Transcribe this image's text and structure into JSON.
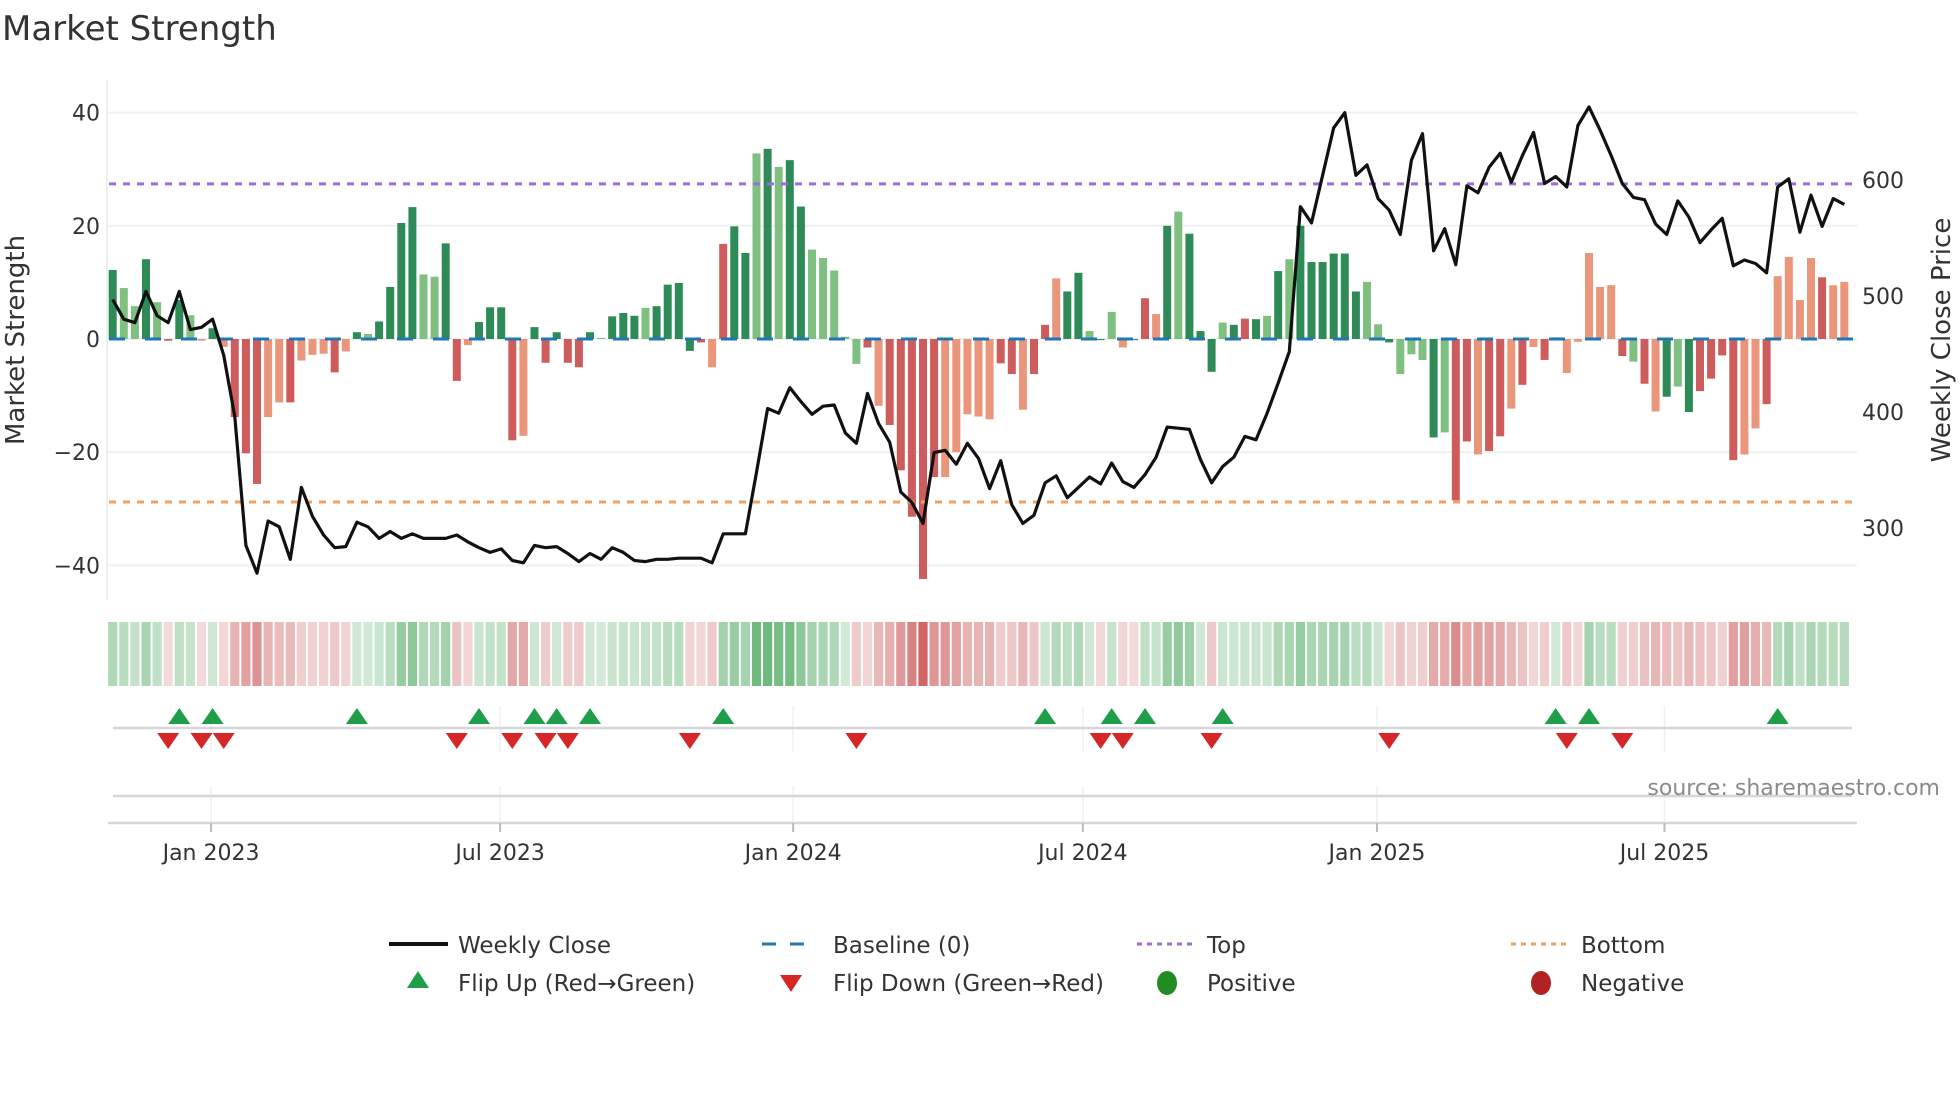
{
  "title": "Market Strength",
  "source": "source: sharemaestro.com",
  "colors": {
    "bar_strong_positive": "#2e8b57",
    "bar_weak_positive": "#7fbf7f",
    "bar_strong_negative": "#cd5c5c",
    "bar_weak_negative": "#e9967a",
    "baseline": "#1f77b4",
    "top": "#9b6cdc",
    "bottom": "#f0a060",
    "close": "#111111",
    "flip_up": "#1f9e4a",
    "flip_down": "#d62728",
    "positive": "#228b22",
    "negative": "#b22222"
  },
  "legend": {
    "weekly_close": "Weekly Close",
    "baseline": "Baseline (0)",
    "top": "Top",
    "bottom": "Bottom",
    "flip_up": "Flip Up (Red→Green)",
    "flip_down": "Flip Down (Green→Red)",
    "positive": "Positive",
    "negative": "Negative"
  },
  "chart_data": {
    "type": "bar",
    "title": "Market Strength",
    "ylabel": "Market Strength",
    "y2label": "Weekly Close Price",
    "ylim": [
      -46,
      46
    ],
    "y2lim": [
      238,
      686
    ],
    "y_ticks": [
      "40",
      "20",
      "0",
      "−20",
      "−40"
    ],
    "y_tick_values": [
      40,
      20,
      0,
      -20,
      -40
    ],
    "y2_ticks": [
      "600",
      "500",
      "400",
      "300"
    ],
    "y2_tick_values": [
      600,
      500,
      400,
      300
    ],
    "x_ticks": [
      "Jan 2023",
      "Jul 2023",
      "Jan 2024",
      "Jul 2024",
      "Jan 2025",
      "Jul 2025"
    ],
    "x_tick_week_positions": [
      8.86,
      34.9,
      61.3,
      87.4,
      113.9,
      139.8
    ],
    "top_level": 27.4,
    "bottom_level": -28.8,
    "baseline": 0,
    "strength": [
      12.2,
      9,
      5.8,
      14.1,
      6.5,
      -0.3,
      6.9,
      4.2,
      -0.3,
      1.9,
      -1.4,
      -13.8,
      -20.2,
      -25.6,
      -13.8,
      -11.2,
      -11.2,
      -3.8,
      -2.8,
      -2.6,
      -5.9,
      -2.2,
      1.2,
      0.9,
      3.1,
      9.2,
      20.5,
      23.3,
      11.4,
      11,
      16.9,
      -7.4,
      -1.1,
      3,
      5.6,
      5.6,
      -17.9,
      -17.1,
      2.1,
      -4.2,
      1.2,
      -4.2,
      -5,
      1.2,
      0.2,
      4,
      4.6,
      4.1,
      5.5,
      5.8,
      9.6,
      9.9,
      -2.1,
      -0.6,
      -5,
      16.8,
      19.9,
      15.2,
      32.8,
      33.6,
      30.4,
      31.6,
      23.4,
      15.8,
      14.3,
      12.1,
      0.4,
      -4.4,
      -1.5,
      -11.8,
      -15.2,
      -23.2,
      -31.4,
      -42.4,
      -24.4,
      -24.4,
      -20,
      -13.3,
      -13.7,
      -14.2,
      -4.3,
      -6.2,
      -12.5,
      -6.2,
      2.5,
      10.7,
      8.4,
      11.7,
      1.4,
      -0.2,
      4.8,
      -1.5,
      -0.2,
      7.2,
      4.4,
      20,
      22.5,
      18.6,
      1.4,
      -5.8,
      2.9,
      2.5,
      3.6,
      3.5,
      4.1,
      12,
      14.1,
      20,
      13.6,
      13.6,
      15.1,
      15.1,
      8.4,
      10.1,
      2.6,
      -0.6,
      -6.2,
      -2.7,
      -3.7,
      -17.4,
      -16.5,
      -28.5,
      -18.1,
      -20.4,
      -19.8,
      -17.2,
      -12.3,
      -8.1,
      -1.4,
      -3.7,
      0.3,
      -6,
      -0.5,
      15.2,
      9.2,
      9.5,
      -3,
      -4,
      -7.9,
      -12.8,
      -10.2,
      -8.4,
      -12.9,
      -9.2,
      -7,
      -2.9,
      -21.4,
      -20.4,
      -15.8,
      -11.5,
      11.1,
      14.5,
      6.9,
      14.3,
      10.9,
      9.5,
      10.1
    ],
    "shade": "dlldlrdlsdsrrrssrsssrsdlddddlldrsdddrsdrdrrdldddlddddrsrddldlddlllllrsrrrrrsssssrrsrrsddldlsdrsdldddldrdldlddddddlldllldlrrsrrsrsrssssssrlrsdldrrrrssrssssrsssddldlld",
    "weekly_close": [
      497,
      480,
      477,
      504,
      483,
      477,
      504,
      471,
      473,
      480,
      449,
      396,
      285,
      261,
      306,
      301,
      273,
      335,
      310,
      294,
      283,
      284,
      305,
      301,
      291,
      297,
      291,
      295,
      291,
      291,
      291,
      294,
      288,
      283,
      279,
      282,
      272,
      270,
      285,
      283,
      284,
      278,
      271,
      278,
      273,
      283,
      279,
      272,
      271,
      273,
      273,
      274,
      274,
      274,
      270,
      295,
      295,
      295,
      348,
      403,
      399,
      421,
      409,
      398,
      405,
      406,
      382,
      373,
      416,
      390,
      374,
      331,
      322,
      304,
      365,
      367,
      355,
      373,
      360,
      334,
      358,
      320,
      304,
      311,
      339,
      345,
      326,
      335,
      344,
      338,
      356,
      340,
      335,
      346,
      361,
      387,
      386,
      385,
      359,
      339,
      353,
      361,
      379,
      376,
      399,
      425,
      452,
      577,
      563,
      604,
      645,
      658,
      604,
      613,
      584,
      574,
      553,
      617,
      640,
      539,
      558,
      527,
      595,
      589,
      611,
      623,
      598,
      621,
      641,
      597,
      603,
      594,
      647,
      663,
      643,
      621,
      597,
      585,
      583,
      562,
      553,
      582,
      568,
      546,
      557,
      567,
      526,
      531,
      528,
      520,
      594,
      601,
      555,
      587,
      560,
      584,
      579
    ],
    "flip_up_weeks": [
      7,
      10,
      23,
      34,
      39,
      41,
      44,
      56,
      85,
      91,
      94,
      101,
      131,
      134,
      151
    ],
    "flip_down_weeks": [
      6,
      9,
      11,
      32,
      37,
      40,
      42,
      53,
      68,
      90,
      92,
      100,
      116,
      132,
      137
    ],
    "legend_position": "bottom"
  }
}
